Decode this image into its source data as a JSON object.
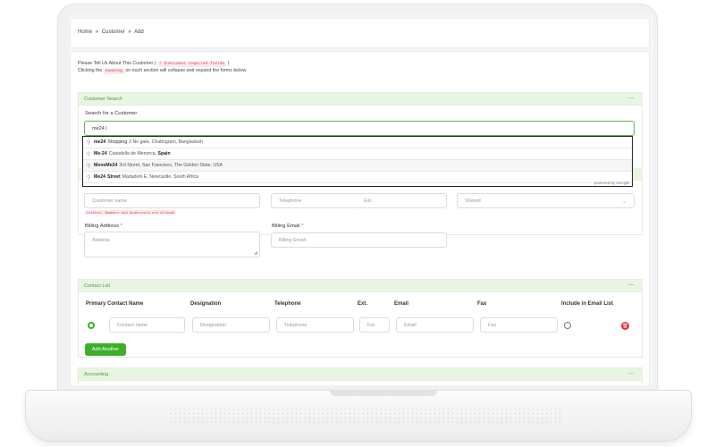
{
  "breadcrumb": {
    "items": [
      "Home",
      "Customer",
      "Add"
    ],
    "separator": "»"
  },
  "intro": {
    "line1_prefix": "Please Tell Us About This Customer (",
    "required_tag": "* Indicates required fields",
    "line1_suffix": ")",
    "line2_prefix": "Clicking the",
    "heading_tag": "heading",
    "line2_suffix": "on each section will collapse and expand the forms below."
  },
  "customer_search": {
    "title": "Customer Search",
    "toggle": "—",
    "label": "Search for a Customer",
    "value": "me24 |"
  },
  "autocomplete": {
    "results": [
      {
        "match": "me24",
        "name": "Shopping",
        "address": "2 No gate, Chattogram, Bangladesh",
        "bold_tail": ""
      },
      {
        "match": "Me-24",
        "name": "",
        "address": "Ciutadella de Menorca,",
        "bold_tail": "Spain"
      },
      {
        "match": "MoveMe24",
        "name": "",
        "address": "3rd Street, San Francisco, The Golden State, USA",
        "bold_tail": ""
      },
      {
        "match": "Me24",
        "name": "Street",
        "address": "Madadeni E, Newcastle, South Africa",
        "bold_tail": ""
      }
    ],
    "powered_by": "powered by",
    "google": [
      "G",
      "o",
      "o",
      "g",
      "l",
      "e"
    ]
  },
  "customer_info": {
    "name_placeholder": "Customer name",
    "name_hint": "Letters, Numbers and Underscore are Allowed",
    "telephone_placeholder": "Telephone",
    "ext_placeholder": "Ext.",
    "shared_value": "Shared",
    "billing_address_label": "Billing Address",
    "billing_address_placeholder": "Address",
    "billing_email_label": "Billing Email",
    "billing_email_placeholder": "Billing Email",
    "required_mark": "*"
  },
  "contact_list": {
    "title": "Contact List",
    "toggle": "—",
    "headers": [
      "Primary Contact Name",
      "Designation",
      "Telephone",
      "Ext.",
      "Email",
      "Fax",
      "Include in Email List"
    ],
    "row": {
      "name_placeholder": "Contact name",
      "designation_placeholder": "Designation",
      "telephone_placeholder": "Telephone",
      "ext_placeholder": "Ext.",
      "email_placeholder": "Email",
      "fax_placeholder": "Fax",
      "primary_selected": true,
      "include_in_email": false
    },
    "add_button": "Add Another"
  },
  "accounting": {
    "title": "Accounting",
    "toggle": "—"
  },
  "colors": {
    "accent": "#3fae2a",
    "section_bg": "#e9f5e3",
    "section_title": "#4a9a33",
    "danger": "#e8303a"
  }
}
